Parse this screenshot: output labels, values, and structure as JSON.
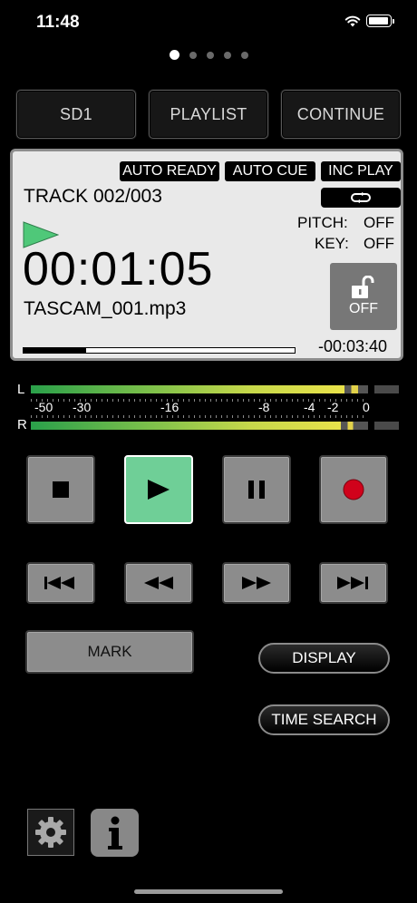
{
  "status_bar": {
    "time": "11:48"
  },
  "pager": {
    "count": 5,
    "active": 0
  },
  "top_buttons": {
    "sd": "SD1",
    "playlist": "PLAYLIST",
    "continue": "CONTINUE"
  },
  "display": {
    "tags": {
      "auto_ready": "AUTO READY",
      "auto_cue": "AUTO CUE",
      "inc_play": "INC PLAY"
    },
    "track": "TRACK 002/003",
    "pitch_label": "PITCH:",
    "pitch_value": "OFF",
    "key_label": "KEY:",
    "key_value": "OFF",
    "timecode": "00:01:05",
    "filename": "TASCAM_001.mp3",
    "lock_label": "OFF",
    "remaining": "-00:03:40",
    "progress": 0.23
  },
  "meter": {
    "left_label": "L",
    "right_label": "R",
    "scale": [
      "-50",
      "-30",
      "-16",
      "-8",
      "-4",
      "-2",
      "0"
    ]
  },
  "controls": {
    "mark": "MARK",
    "display": "DISPLAY",
    "time_search": "TIME SEARCH"
  },
  "colors": {
    "play_active": "#6fcf97",
    "record": "#d0021b"
  }
}
